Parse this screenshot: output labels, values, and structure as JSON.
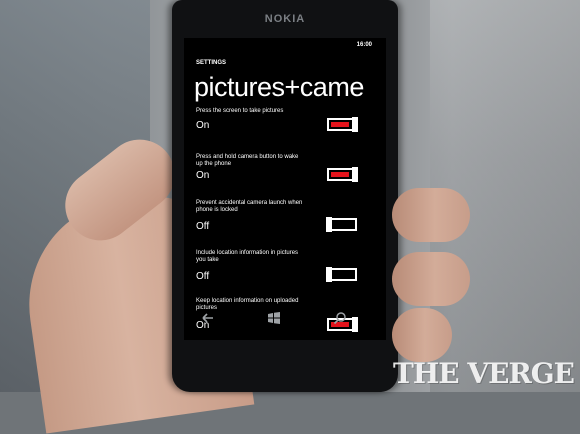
{
  "phone": {
    "brand": "NOKIA"
  },
  "status": {
    "time": "16:00"
  },
  "app_title": "SETTINGS",
  "page_title": "pictures+came",
  "settings": [
    {
      "label": "Press the screen to take pictures",
      "state": "On",
      "enabled": true
    },
    {
      "label": "Press and hold camera button to wake up the phone",
      "state": "On",
      "enabled": true
    },
    {
      "label": "Prevent accidental camera launch when phone is locked",
      "state": "Off",
      "enabled": false
    },
    {
      "label": "Include location information in pictures you take",
      "state": "Off",
      "enabled": false
    },
    {
      "label": "Keep location information on uploaded pictures",
      "state": "On",
      "enabled": true
    }
  ],
  "appbar": {
    "back": "back-icon",
    "start": "windows-icon",
    "search": "search-icon"
  },
  "accent_color": "#e3131b",
  "watermark": "THE VERGE"
}
